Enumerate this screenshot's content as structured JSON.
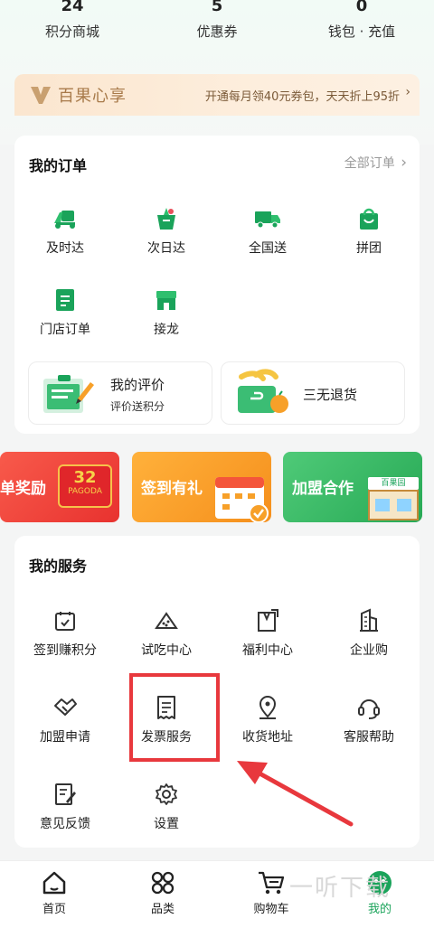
{
  "stats": [
    {
      "value": "24",
      "label": "积分商城"
    },
    {
      "value": "5",
      "label": "优惠券"
    },
    {
      "value": "0",
      "label": "钱包 · 充值"
    }
  ],
  "vip": {
    "brand": "百果心享",
    "promo": "开通每月领40元券包，天天折上95折",
    "arrow": "›"
  },
  "orders": {
    "title": "我的订单",
    "all_label": "全部订单",
    "all_arrow": "›",
    "items": [
      "及时达",
      "次日达",
      "全国送",
      "拼团",
      "门店订单",
      "接龙"
    ],
    "review_title": "我的评价",
    "review_sub": "评价送积分",
    "refund_title": "三无退货"
  },
  "banners": [
    {
      "label": "单奖励",
      "badge": "32",
      "pagoda": "PAGODA",
      "color": "#f2423e"
    },
    {
      "label": "签到有礼",
      "color": "#f7a029"
    },
    {
      "label": "加盟合作",
      "store_sign": "百果园",
      "color": "#3bb162"
    }
  ],
  "services": {
    "title": "我的服务",
    "items": [
      "签到赚积分",
      "试吃中心",
      "福利中心",
      "企业购",
      "加盟申请",
      "发票服务",
      "收货地址",
      "客服帮助",
      "意见反馈",
      "设置"
    ]
  },
  "nav": [
    {
      "label": "首页",
      "icon": "home-icon"
    },
    {
      "label": "品类",
      "icon": "category-icon"
    },
    {
      "label": "购物车",
      "icon": "cart-icon"
    },
    {
      "label": "我的",
      "icon": "profile-icon"
    }
  ],
  "watermark": "一听下载",
  "colors": {
    "accent": "#1aa35a",
    "highlight": "#e8383d"
  }
}
